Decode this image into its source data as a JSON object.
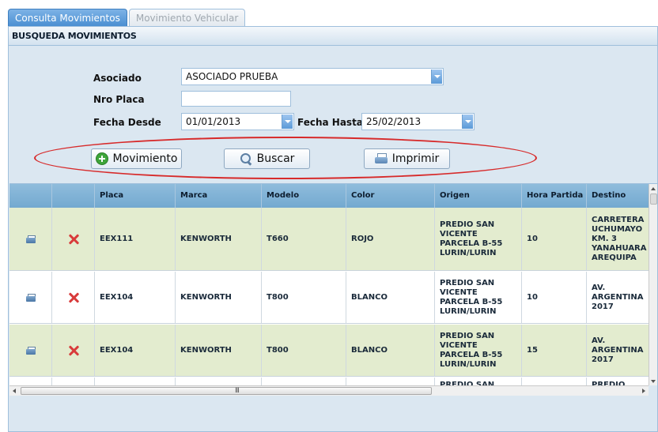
{
  "tabs": [
    {
      "label": "Consulta Movimientos",
      "active": true
    },
    {
      "label": "Movimiento Vehicular",
      "active": false
    }
  ],
  "panel": {
    "title": "BUSQUEDA MOVIMIENTOS"
  },
  "form": {
    "asociado_label": "Asociado",
    "asociado_value": "ASOCIADO PRUEBA",
    "placa_label": "Nro Placa",
    "placa_value": "",
    "fecha_desde_label": "Fecha Desde",
    "fecha_desde_value": "01/01/2013",
    "fecha_hasta_label": "Fecha Hasta",
    "fecha_hasta_value": "25/02/2013"
  },
  "buttons": {
    "movimiento": "Movimiento",
    "buscar": "Buscar",
    "imprimir": "Imprimir"
  },
  "grid": {
    "columns": [
      "Placa",
      "Marca",
      "Modelo",
      "Color",
      "Origen",
      "Hora Partida",
      "Destino"
    ],
    "rows": [
      {
        "placa": "EEX111",
        "marca": "KENWORTH",
        "modelo": "T660",
        "color": "ROJO",
        "origen": "PREDIO SAN VICENTE PARCELA B-55 LURIN/LURIN",
        "hora": "10",
        "destino": "CARRETERA UCHUMAYO KM. 3 YANAHUARA AREQUIPA"
      },
      {
        "placa": "EEX104",
        "marca": "KENWORTH",
        "modelo": "T800",
        "color": "BLANCO",
        "origen": "PREDIO SAN VICENTE PARCELA B-55 LURIN/LURIN",
        "hora": "10",
        "destino": "AV. ARGENTINA 2017"
      },
      {
        "placa": "EEX104",
        "marca": "KENWORTH",
        "modelo": "T800",
        "color": "BLANCO",
        "origen": "PREDIO SAN VICENTE PARCELA B-55 LURIN/LURIN",
        "hora": "15",
        "destino": "AV. ARGENTINA 2017"
      },
      {
        "placa": "",
        "marca": "",
        "modelo": "",
        "color": "",
        "origen": "PREDIO SAN",
        "hora": "",
        "destino": "PREDIO"
      }
    ]
  },
  "scrollbar": {
    "grip": "III"
  },
  "colors": {
    "tab_active": "#4b8fd2",
    "header": "#73a9d0",
    "row_alt": "#e3eccf",
    "highlight_ellipse": "#d72a2a"
  }
}
